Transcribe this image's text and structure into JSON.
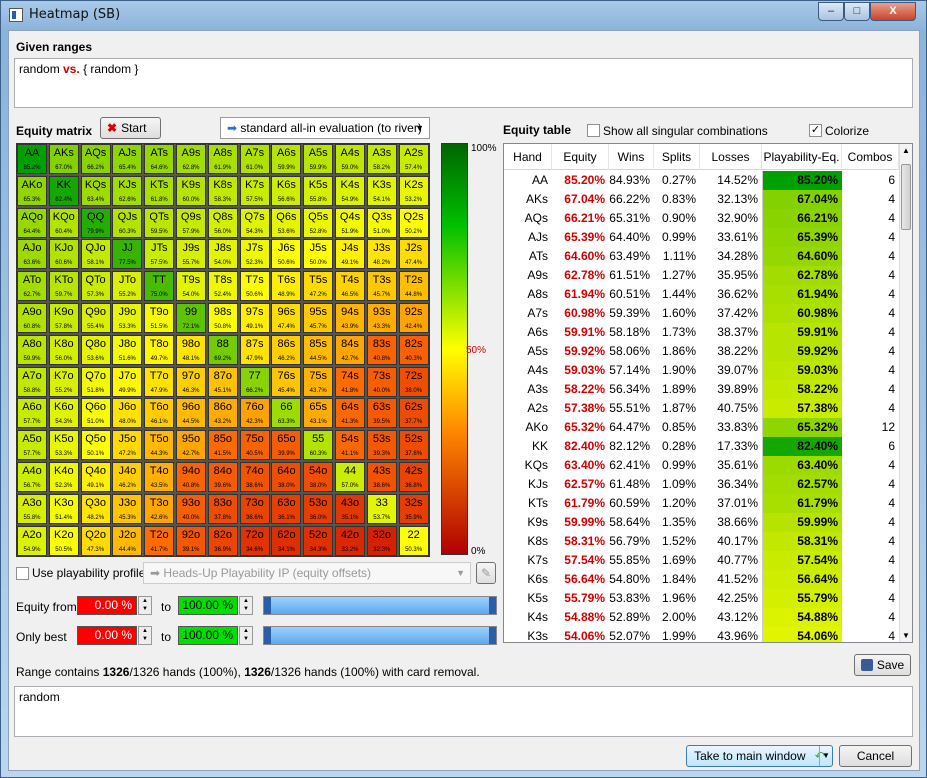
{
  "window": {
    "title": "Heatmap (SB)",
    "min": "–",
    "max": "□",
    "close": "X"
  },
  "given_ranges": {
    "label": "Given ranges",
    "value_a": "random",
    "vs": "vs.",
    "value_b": "{ random }"
  },
  "equity_matrix": {
    "label": "Equity matrix",
    "start_label": "Start",
    "mode": "standard all-in evaluation (to river)"
  },
  "legend": {
    "top": "100%",
    "mid": "50%",
    "bottom": "0%"
  },
  "matrix": [
    [
      "AA",
      "85.2%",
      "AKs",
      "67.0%",
      "AQs",
      "66.2%",
      "AJs",
      "65.4%",
      "ATs",
      "64.6%",
      "A9s",
      "62.8%",
      "A8s",
      "61.9%",
      "A7s",
      "61.0%",
      "A6s",
      "59.9%",
      "A5s",
      "59.9%",
      "A4s",
      "59.0%",
      "A3s",
      "58.2%",
      "A2s",
      "57.4%"
    ],
    [
      "AKo",
      "65.3%",
      "KK",
      "82.4%",
      "KQs",
      "63.4%",
      "KJs",
      "62.6%",
      "KTs",
      "61.8%",
      "K9s",
      "60.0%",
      "K8s",
      "58.3%",
      "K7s",
      "57.5%",
      "K6s",
      "56.6%",
      "K5s",
      "55.8%",
      "K4s",
      "54.9%",
      "K3s",
      "54.1%",
      "K2s",
      "53.2%"
    ],
    [
      "AQo",
      "64.4%",
      "KQo",
      "60.4%",
      "QQ",
      "79.9%",
      "QJs",
      "60.3%",
      "QTs",
      "59.5%",
      "Q9s",
      "57.9%",
      "Q8s",
      "56.0%",
      "Q7s",
      "54.3%",
      "Q6s",
      "53.6%",
      "Q5s",
      "52.8%",
      "Q4s",
      "51.9%",
      "Q3s",
      "51.0%",
      "Q2s",
      "50.2%"
    ],
    [
      "AJo",
      "63.6%",
      "KJo",
      "60.6%",
      "QJo",
      "58.1%",
      "JJ",
      "77.5%",
      "JTs",
      "57.5%",
      "J9s",
      "55.7%",
      "J8s",
      "54.0%",
      "J7s",
      "52.3%",
      "J6s",
      "50.6%",
      "J5s",
      "50.0%",
      "J4s",
      "49.1%",
      "J3s",
      "48.2%",
      "J2s",
      "47.4%"
    ],
    [
      "ATo",
      "62.7%",
      "KTo",
      "59.7%",
      "QTo",
      "57.3%",
      "JTo",
      "55.2%",
      "TT",
      "75.0%",
      "T9s",
      "54.0%",
      "T8s",
      "52.4%",
      "T7s",
      "50.6%",
      "T6s",
      "48.9%",
      "T5s",
      "47.2%",
      "T4s",
      "46.5%",
      "T3s",
      "45.7%",
      "T2s",
      "44.8%"
    ],
    [
      "A9o",
      "60.8%",
      "K9o",
      "57.8%",
      "Q9o",
      "55.4%",
      "J9o",
      "53.3%",
      "T9o",
      "51.5%",
      "99",
      "72.1%",
      "98s",
      "50.8%",
      "97s",
      "49.1%",
      "96s",
      "47.4%",
      "95s",
      "45.7%",
      "94s",
      "43.9%",
      "93s",
      "43.3%",
      "92s",
      "42.4%"
    ],
    [
      "A8o",
      "59.9%",
      "K8o",
      "56.0%",
      "Q8o",
      "53.6%",
      "J8o",
      "51.6%",
      "T8o",
      "49.7%",
      "98o",
      "48.1%",
      "88",
      "69.2%",
      "87s",
      "47.9%",
      "86s",
      "46.2%",
      "85s",
      "44.5%",
      "84s",
      "42.7%",
      "83s",
      "40.8%",
      "82s",
      "40.3%"
    ],
    [
      "A7o",
      "58.8%",
      "K7o",
      "55.2%",
      "Q7o",
      "51.8%",
      "J7o",
      "49.9%",
      "T7o",
      "47.9%",
      "97o",
      "46.3%",
      "87o",
      "45.1%",
      "77",
      "66.2%",
      "76s",
      "45.4%",
      "75s",
      "43.7%",
      "74s",
      "41.8%",
      "73s",
      "40.0%",
      "72s",
      "38.0%"
    ],
    [
      "A6o",
      "57.7%",
      "K6o",
      "54.3%",
      "Q6o",
      "51.0%",
      "J6o",
      "48.0%",
      "T6o",
      "46.1%",
      "96o",
      "44.5%",
      "86o",
      "43.2%",
      "76o",
      "42.3%",
      "66",
      "63.3%",
      "65s",
      "43.1%",
      "64s",
      "41.3%",
      "63s",
      "39.5%",
      "62s",
      "37.7%"
    ],
    [
      "A5o",
      "57.7%",
      "K5o",
      "53.3%",
      "Q5o",
      "50.1%",
      "J5o",
      "47.2%",
      "T5o",
      "44.3%",
      "95o",
      "42.7%",
      "85o",
      "41.5%",
      "75o",
      "40.5%",
      "65o",
      "39.9%",
      "55",
      "60.3%",
      "54s",
      "41.1%",
      "53s",
      "39.3%",
      "52s",
      "37.8%"
    ],
    [
      "A4o",
      "56.7%",
      "K4o",
      "52.3%",
      "Q4o",
      "49.1%",
      "J4o",
      "46.2%",
      "T4o",
      "43.5%",
      "94o",
      "40.8%",
      "84o",
      "39.6%",
      "74o",
      "38.6%",
      "64o",
      "38.0%",
      "54o",
      "38.0%",
      "44",
      "57.0%",
      "43s",
      "38.6%",
      "42s",
      "36.8%"
    ],
    [
      "A3o",
      "55.8%",
      "K3o",
      "51.4%",
      "Q3o",
      "48.2%",
      "J3o",
      "45.3%",
      "T3o",
      "42.6%",
      "93o",
      "40.0%",
      "83o",
      "37.8%",
      "73o",
      "36.6%",
      "63o",
      "36.1%",
      "53o",
      "36.0%",
      "43o",
      "35.1%",
      "33",
      "53.7%",
      "32s",
      "35.9%"
    ],
    [
      "A2o",
      "54.9%",
      "K2o",
      "50.5%",
      "Q2o",
      "47.3%",
      "J2o",
      "44.4%",
      "T2o",
      "41.7%",
      "92o",
      "39.1%",
      "82o",
      "36.9%",
      "72o",
      "34.6%",
      "62o",
      "34.1%",
      "52o",
      "34.3%",
      "42o",
      "33.2%",
      "32o",
      "32.3%",
      "22",
      "50.3%"
    ]
  ],
  "playability": {
    "label": "Use playability profile:",
    "profile": "Heads-Up Playability IP  (equity offsets)"
  },
  "equity_from": {
    "label": "Equity from",
    "min": "0.00 %",
    "to": "to",
    "max": "100.00 %"
  },
  "only_best": {
    "label": "Only best",
    "min": "0.00 %",
    "to": "to",
    "max": "100.00 %"
  },
  "equity_table": {
    "label": "Equity table",
    "show_all": "Show all singular combinations",
    "colorize": "Colorize",
    "check": "✓",
    "columns": [
      "Hand",
      "Equity",
      "Wins",
      "Splits",
      "Losses",
      "Playability-Eq.",
      "Combos"
    ],
    "rows": [
      [
        "AA",
        "85.20%",
        "84.93%",
        "0.27%",
        "14.52%",
        "85.20%",
        "6"
      ],
      [
        "AKs",
        "67.04%",
        "66.22%",
        "0.83%",
        "32.13%",
        "67.04%",
        "4"
      ],
      [
        "AQs",
        "66.21%",
        "65.31%",
        "0.90%",
        "32.90%",
        "66.21%",
        "4"
      ],
      [
        "AJs",
        "65.39%",
        "64.40%",
        "0.99%",
        "33.61%",
        "65.39%",
        "4"
      ],
      [
        "ATs",
        "64.60%",
        "63.49%",
        "1.11%",
        "34.28%",
        "64.60%",
        "4"
      ],
      [
        "A9s",
        "62.78%",
        "61.51%",
        "1.27%",
        "35.95%",
        "62.78%",
        "4"
      ],
      [
        "A8s",
        "61.94%",
        "60.51%",
        "1.44%",
        "36.62%",
        "61.94%",
        "4"
      ],
      [
        "A7s",
        "60.98%",
        "59.39%",
        "1.60%",
        "37.42%",
        "60.98%",
        "4"
      ],
      [
        "A6s",
        "59.91%",
        "58.18%",
        "1.73%",
        "38.37%",
        "59.91%",
        "4"
      ],
      [
        "A5s",
        "59.92%",
        "58.06%",
        "1.86%",
        "38.22%",
        "59.92%",
        "4"
      ],
      [
        "A4s",
        "59.03%",
        "57.14%",
        "1.90%",
        "39.07%",
        "59.03%",
        "4"
      ],
      [
        "A3s",
        "58.22%",
        "56.34%",
        "1.89%",
        "39.89%",
        "58.22%",
        "4"
      ],
      [
        "A2s",
        "57.38%",
        "55.51%",
        "1.87%",
        "40.75%",
        "57.38%",
        "4"
      ],
      [
        "AKo",
        "65.32%",
        "64.47%",
        "0.85%",
        "33.83%",
        "65.32%",
        "12"
      ],
      [
        "KK",
        "82.40%",
        "82.12%",
        "0.28%",
        "17.33%",
        "82.40%",
        "6"
      ],
      [
        "KQs",
        "63.40%",
        "62.41%",
        "0.99%",
        "35.61%",
        "63.40%",
        "4"
      ],
      [
        "KJs",
        "62.57%",
        "61.48%",
        "1.09%",
        "36.34%",
        "62.57%",
        "4"
      ],
      [
        "KTs",
        "61.79%",
        "60.59%",
        "1.20%",
        "37.01%",
        "61.79%",
        "4"
      ],
      [
        "K9s",
        "59.99%",
        "58.64%",
        "1.35%",
        "38.66%",
        "59.99%",
        "4"
      ],
      [
        "K8s",
        "58.31%",
        "56.79%",
        "1.52%",
        "40.17%",
        "58.31%",
        "4"
      ],
      [
        "K7s",
        "57.54%",
        "55.85%",
        "1.69%",
        "40.77%",
        "57.54%",
        "4"
      ],
      [
        "K6s",
        "56.64%",
        "54.80%",
        "1.84%",
        "41.52%",
        "56.64%",
        "4"
      ],
      [
        "K5s",
        "55.79%",
        "53.83%",
        "1.96%",
        "42.25%",
        "55.79%",
        "4"
      ],
      [
        "K4s",
        "54.88%",
        "52.89%",
        "2.00%",
        "43.12%",
        "54.88%",
        "4"
      ],
      [
        "K3s",
        "54.06%",
        "52.07%",
        "1.99%",
        "43.96%",
        "54.06%",
        "4"
      ]
    ]
  },
  "summary": {
    "prefix": "Range contains ",
    "a": "1326",
    "b": "/1326 hands (100%), ",
    "c": "1326",
    "d": "/1326 hands (100%) with card removal."
  },
  "range_text": "random",
  "buttons": {
    "save": "Save",
    "main": "Take to main window",
    "cancel": "Cancel"
  }
}
